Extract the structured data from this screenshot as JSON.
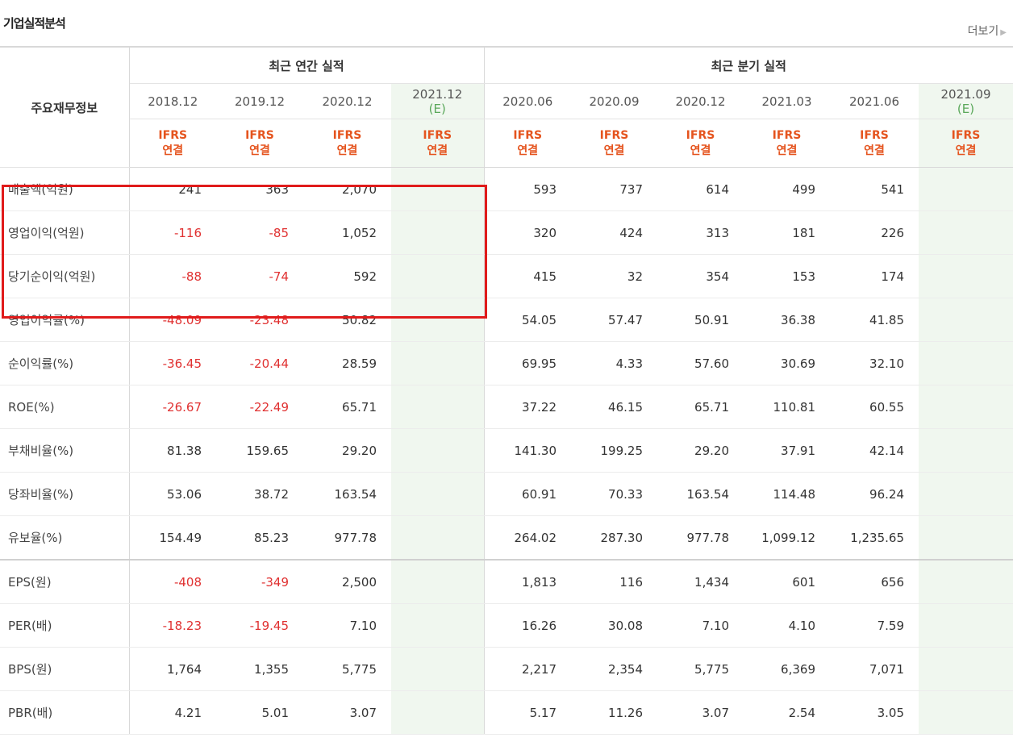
{
  "section": {
    "title": "기업실적분석",
    "more_label": "더보기"
  },
  "header": {
    "row_label": "주요재무정보",
    "annual_label": "최근 연간 실적",
    "quarter_label": "최근 분기 실적",
    "annual_periods": [
      "2018.12",
      "2019.12",
      "2020.12",
      "2021.12"
    ],
    "quarter_periods": [
      "2020.06",
      "2020.09",
      "2020.12",
      "2021.03",
      "2021.06",
      "2021.09"
    ],
    "estimate_mark": "(E)",
    "ifrs_line1": "IFRS",
    "ifrs_line2": "연결"
  },
  "rows": [
    {
      "label": "매출액(억원)",
      "values": [
        "241",
        "363",
        "2,070",
        "",
        "593",
        "737",
        "614",
        "499",
        "541",
        ""
      ]
    },
    {
      "label": "영업이익(억원)",
      "values": [
        "-116",
        "-85",
        "1,052",
        "",
        "320",
        "424",
        "313",
        "181",
        "226",
        ""
      ]
    },
    {
      "label": "당기순이익(억원)",
      "values": [
        "-88",
        "-74",
        "592",
        "",
        "415",
        "32",
        "354",
        "153",
        "174",
        ""
      ]
    },
    {
      "label": "영업이익률(%)",
      "values": [
        "-48.09",
        "-23.48",
        "50.82",
        "",
        "54.05",
        "57.47",
        "50.91",
        "36.38",
        "41.85",
        ""
      ]
    },
    {
      "label": "순이익률(%)",
      "values": [
        "-36.45",
        "-20.44",
        "28.59",
        "",
        "69.95",
        "4.33",
        "57.60",
        "30.69",
        "32.10",
        ""
      ]
    },
    {
      "label": "ROE(%)",
      "values": [
        "-26.67",
        "-22.49",
        "65.71",
        "",
        "37.22",
        "46.15",
        "65.71",
        "110.81",
        "60.55",
        ""
      ]
    },
    {
      "label": "부채비율(%)",
      "values": [
        "81.38",
        "159.65",
        "29.20",
        "",
        "141.30",
        "199.25",
        "29.20",
        "37.91",
        "42.14",
        ""
      ]
    },
    {
      "label": "당좌비율(%)",
      "values": [
        "53.06",
        "38.72",
        "163.54",
        "",
        "60.91",
        "70.33",
        "163.54",
        "114.48",
        "96.24",
        ""
      ]
    },
    {
      "label": "유보율(%)",
      "values": [
        "154.49",
        "85.23",
        "977.78",
        "",
        "264.02",
        "287.30",
        "977.78",
        "1,099.12",
        "1,235.65",
        ""
      ]
    },
    {
      "label": "EPS(원)",
      "values": [
        "-408",
        "-349",
        "2,500",
        "",
        "1,813",
        "116",
        "1,434",
        "601",
        "656",
        ""
      ]
    },
    {
      "label": "PER(배)",
      "values": [
        "-18.23",
        "-19.45",
        "7.10",
        "",
        "16.26",
        "30.08",
        "7.10",
        "4.10",
        "7.59",
        ""
      ]
    },
    {
      "label": "BPS(원)",
      "values": [
        "1,764",
        "1,355",
        "5,775",
        "",
        "2,217",
        "2,354",
        "5,775",
        "6,369",
        "7,071",
        ""
      ]
    },
    {
      "label": "PBR(배)",
      "values": [
        "4.21",
        "5.01",
        "3.07",
        "",
        "5.17",
        "11.26",
        "3.07",
        "2.54",
        "3.05",
        ""
      ]
    }
  ],
  "colors": {
    "negative": "#e03131",
    "estimate": "#5ba85b",
    "ifrs": "#e5541e",
    "highlight": "#e01b1b"
  }
}
